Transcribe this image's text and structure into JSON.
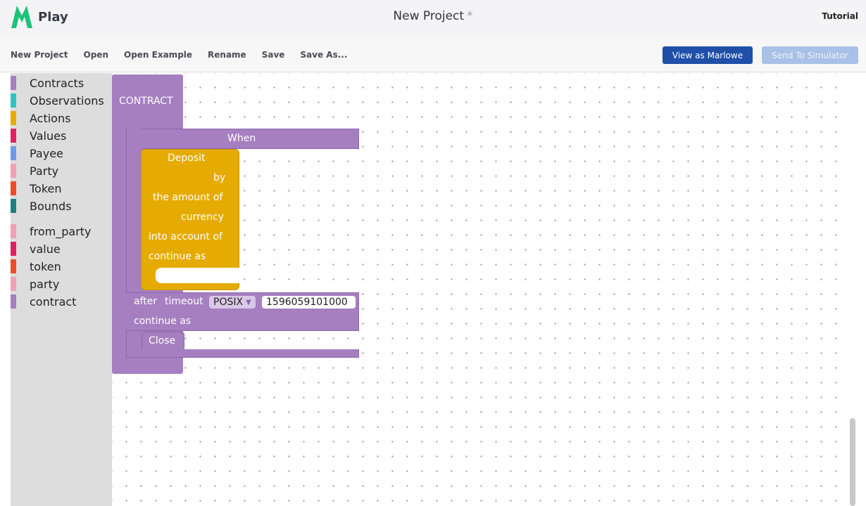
{
  "header": {
    "logo_text": "Play",
    "title": "New Project",
    "unsaved_mark": "*",
    "tutorial": "Tutorial"
  },
  "toolbar": {
    "new_project": "New Project",
    "open": "Open",
    "open_example": "Open Example",
    "rename": "Rename",
    "save": "Save",
    "save_as": "Save As...",
    "view_as_marlowe": "View as Marlowe",
    "send_to_simulator": "Send To Simulator"
  },
  "toolbox": {
    "categories": [
      {
        "label": "Contracts",
        "color": "#a57fc0"
      },
      {
        "label": "Observations",
        "color": "#2ec4c4"
      },
      {
        "label": "Actions",
        "color": "#e6ab00"
      },
      {
        "label": "Values",
        "color": "#e31f5f"
      },
      {
        "label": "Payee",
        "color": "#6f9ae8"
      },
      {
        "label": "Party",
        "color": "#f0a0b4"
      },
      {
        "label": "Token",
        "color": "#ef4a2a"
      },
      {
        "label": "Bounds",
        "color": "#1f8080"
      }
    ],
    "holes": [
      {
        "label": "from_party",
        "color": "#f0a0b4"
      },
      {
        "label": "value",
        "color": "#e31f5f"
      },
      {
        "label": "token",
        "color": "#ef4a2a"
      },
      {
        "label": "party",
        "color": "#f0a0b4"
      },
      {
        "label": "contract",
        "color": "#a57fc0"
      }
    ]
  },
  "workspace": {
    "contract_label": "CONTRACT",
    "when_label": "When",
    "deposit": {
      "title": "Deposit",
      "by": "by",
      "amount": "the amount of",
      "currency": "currency",
      "into_account": "into account of",
      "continue_as": "continue as"
    },
    "after": "after",
    "timeout": "timeout",
    "timeout_type": "POSIX",
    "timeout_value": "1596059101000",
    "continue_as": "continue as",
    "close_label": "Close"
  }
}
